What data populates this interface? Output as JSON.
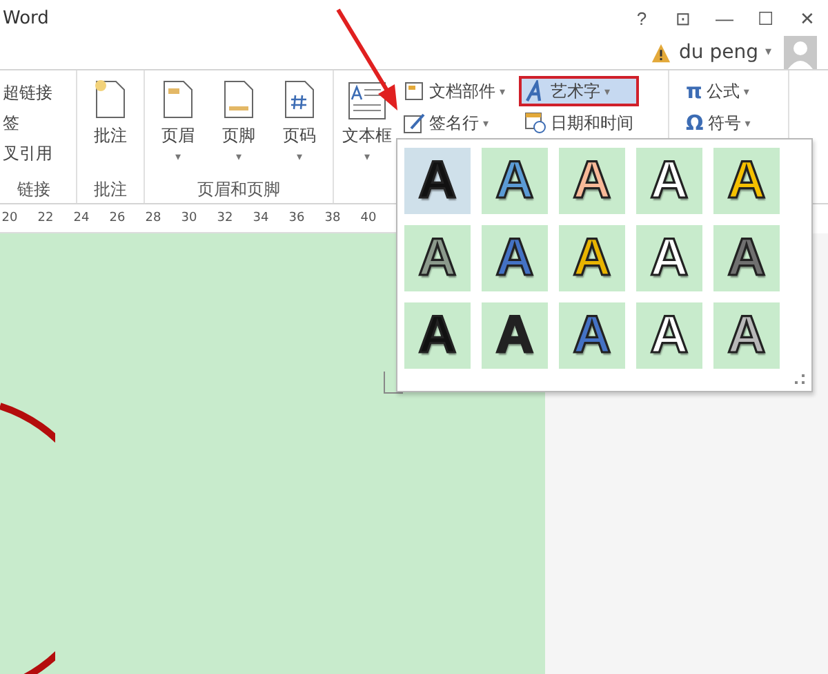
{
  "window": {
    "title": "Word",
    "controls": [
      "?",
      "⊡",
      "—",
      "☐",
      "✕"
    ]
  },
  "user": {
    "name": "du peng",
    "caret": "▾"
  },
  "ribbon": {
    "groups": [
      {
        "kind": "list",
        "label": "链接",
        "items": [
          "超链接",
          "签",
          "叉引用"
        ]
      },
      {
        "kind": "big",
        "label": "批注",
        "items": [
          {
            "label": "批注",
            "kind": "note"
          }
        ]
      },
      {
        "kind": "big",
        "label": "页眉和页脚",
        "items": [
          {
            "label": "页眉",
            "kind": "header",
            "caret": "▾"
          },
          {
            "label": "页脚",
            "kind": "footer",
            "caret": "▾"
          },
          {
            "label": "页码",
            "kind": "pagenum",
            "caret": "▾"
          }
        ]
      },
      {
        "kind": "text",
        "big": {
          "label": "文本框",
          "kind": "textbox",
          "caret": "▾"
        },
        "small": [
          {
            "label": "文档部件",
            "kind": "parts",
            "caret": "▾",
            "selected": false
          },
          {
            "label": "艺术字",
            "kind": "wordart",
            "caret": "▾",
            "selected": true
          },
          {
            "label": "签名行",
            "kind": "sign",
            "caret": "▾",
            "selected": false
          },
          {
            "label": "日期和时间",
            "kind": "date",
            "selected": false
          }
        ]
      },
      {
        "kind": "symbols",
        "small": [
          {
            "label": "公式",
            "symbol": "π",
            "caret": "▾"
          },
          {
            "label": "符号",
            "symbol": "Ω",
            "caret": "▾"
          }
        ]
      }
    ]
  },
  "ruler": [
    "20",
    "22",
    "24",
    "26",
    "28",
    "30",
    "32",
    "34",
    "36",
    "38",
    "40"
  ],
  "wordart_gallery": [
    {
      "letter": "A",
      "color": "#111111",
      "selected": true
    },
    {
      "letter": "A",
      "color": "#5b9bd5",
      "selected": false
    },
    {
      "letter": "A",
      "color": "#f8b998",
      "selected": false
    },
    {
      "letter": "A",
      "color": "#ffffff",
      "selected": false
    },
    {
      "letter": "A",
      "color": "#f5c000",
      "selected": false
    },
    {
      "letter": "A",
      "color": "#8c9a8c",
      "selected": false
    },
    {
      "letter": "A",
      "color": "#4472c4",
      "selected": false
    },
    {
      "letter": "A",
      "color": "#e8b400",
      "selected": false
    },
    {
      "letter": "A",
      "color": "#ffffff",
      "selected": false
    },
    {
      "letter": "A",
      "color": "#707070",
      "selected": false
    },
    {
      "letter": "A",
      "color": "#111111",
      "selected": false
    },
    {
      "letter": "A",
      "color": "#222222",
      "selected": false
    },
    {
      "letter": "A",
      "color": "#4472c4",
      "selected": false
    },
    {
      "letter": "A",
      "color": "#ffffff",
      "selected": false
    },
    {
      "letter": "A",
      "color": "#b8b8b8",
      "selected": false
    }
  ]
}
